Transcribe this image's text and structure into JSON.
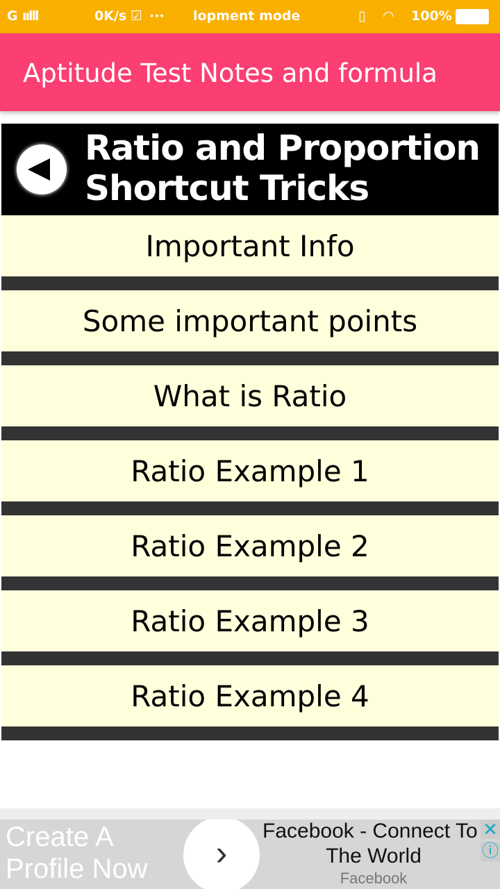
{
  "status_bar": {
    "network": "G",
    "speed": "0K/s",
    "notification": "lopment mode",
    "battery": "100%"
  },
  "app_bar": {
    "title": "Aptitude Test Notes and formula"
  },
  "header": {
    "title_line1": "Ratio and Proportion",
    "title_line2": "Shortcut Tricks"
  },
  "items": [
    {
      "label": "Important Info"
    },
    {
      "label": "Some important points"
    },
    {
      "label": "What is Ratio"
    },
    {
      "label": "Ratio Example 1"
    },
    {
      "label": "Ratio Example 2"
    },
    {
      "label": "Ratio Example 3"
    },
    {
      "label": "Ratio Example 4"
    }
  ],
  "ad": {
    "cta_line1": "Create A",
    "cta_line2": "Profile Now",
    "title_line1": "Facebook - Connect To",
    "title_line2": "The World",
    "source": "Facebook"
  }
}
